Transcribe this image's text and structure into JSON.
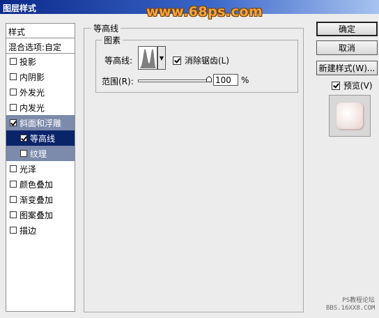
{
  "window": {
    "title": "图层样式"
  },
  "watermark": {
    "text": "www.68ps.com",
    "bottom_line1": "PS教程论坛",
    "bottom_line2": "BBS.16XX8.COM"
  },
  "sidebar": {
    "header": "样式",
    "blend_options": "混合选项:自定",
    "items": [
      {
        "label": "投影",
        "checked": false
      },
      {
        "label": "内阴影",
        "checked": false
      },
      {
        "label": "外发光",
        "checked": false
      },
      {
        "label": "内发光",
        "checked": false
      },
      {
        "label": "斜面和浮雕",
        "checked": true
      },
      {
        "label": "等高线",
        "checked": true
      },
      {
        "label": "纹理",
        "checked": false
      },
      {
        "label": "光泽",
        "checked": false
      },
      {
        "label": "颜色叠加",
        "checked": false
      },
      {
        "label": "渐变叠加",
        "checked": false
      },
      {
        "label": "图案叠加",
        "checked": false
      },
      {
        "label": "描边",
        "checked": false
      }
    ]
  },
  "panel": {
    "group_title": "等高线",
    "subgroup_title": "图素",
    "contour_label": "等高线:",
    "antialias_label": "消除锯齿(L)",
    "antialias_checked": true,
    "range_label": "范围(R):",
    "range_value": "100",
    "range_unit": "%",
    "range_level": 1.0
  },
  "buttons": {
    "ok": "确定",
    "cancel": "取消",
    "new_style": "新建样式(W)...",
    "preview_label": "预览(V)",
    "preview_checked": true
  }
}
